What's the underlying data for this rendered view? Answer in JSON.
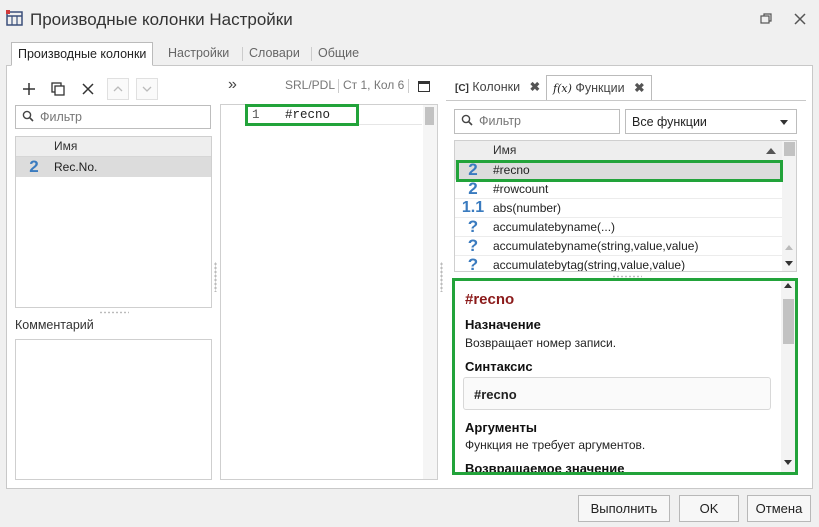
{
  "window": {
    "title": "Производные колонки Настройки",
    "restore_icon": "restore-icon",
    "close_icon": "close-icon"
  },
  "outer_tabs": [
    {
      "label": "Производные колонки",
      "active": true
    },
    {
      "label": "Настройки",
      "active": false
    },
    {
      "label": "Словари",
      "active": false
    },
    {
      "label": "Общие",
      "active": false
    }
  ],
  "left_panel": {
    "toolbar": [
      "add-icon",
      "copy-icon",
      "delete-icon",
      "move-up-icon",
      "move-down-icon"
    ],
    "filter_placeholder": "Фильтр",
    "grid_header": "Имя",
    "rows": [
      {
        "icon": "2",
        "name": "Rec.No."
      }
    ],
    "comment_label": "Комментарий"
  },
  "middle_panel": {
    "expand_label": "»",
    "mode_label": "SRL/PDL",
    "position_label": "Ст 1, Кол 6",
    "code_lines": [
      {
        "num": "1",
        "text": "#recno"
      }
    ]
  },
  "right_panel": {
    "tabs": [
      {
        "prefix": "[C]",
        "label": "Колонки",
        "active": false
      },
      {
        "prefix": "f(x)",
        "label": "Функции",
        "active": true
      }
    ],
    "filter_placeholder": "Фильтр",
    "function_filter": "Все функции",
    "grid_header": "Имя",
    "functions": [
      {
        "icon": "2",
        "name": "#recno"
      },
      {
        "icon": "2",
        "name": "#rowcount"
      },
      {
        "icon": "1.1",
        "name": "abs(number)"
      },
      {
        "icon": "?",
        "name": "accumulatebyname(...)"
      },
      {
        "icon": "?",
        "name": "accumulatebyname(string,value,value)"
      },
      {
        "icon": "?",
        "name": "accumulatebytag(string,value,value)"
      }
    ],
    "help": {
      "title": "#recno",
      "purpose_heading": "Назначение",
      "purpose_text": "Возвращает номер записи.",
      "syntax_heading": "Синтаксис",
      "syntax_text": "#recno",
      "args_heading": "Аргументы",
      "args_text": "Функция не требует аргументов.",
      "return_heading": "Возвращаемое значение"
    }
  },
  "buttons": {
    "run": "Выполнить",
    "ok": "OK",
    "cancel": "Отмена"
  },
  "colors": {
    "highlight_border": "#22a33a",
    "help_title": "#8b1a1a",
    "number_icon": "#3a7bbf"
  }
}
